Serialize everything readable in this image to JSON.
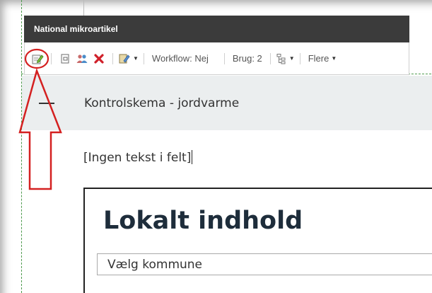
{
  "ribbon": {
    "title": "National mikroartikel",
    "workflow_label": "Workflow: Nej",
    "usage_label": "Brug: 2",
    "more_label": "Flere"
  },
  "section": {
    "title": "Kontrolskema - jordvarme",
    "empty_text": "[Ingen tekst i felt]"
  },
  "local_content": {
    "title": "Lokalt indhold",
    "municipality_select": "Vælg kommune"
  },
  "colors": {
    "ribbon_header": "#3b3b3b",
    "section_header": "#ebeeef",
    "annotation_red": "#d42020",
    "dashed_border": "#4e9a4e"
  },
  "icons": [
    "edit-icon",
    "copy-icon",
    "users-icon",
    "delete-icon",
    "edit-dropdown-icon",
    "tree-icon"
  ]
}
